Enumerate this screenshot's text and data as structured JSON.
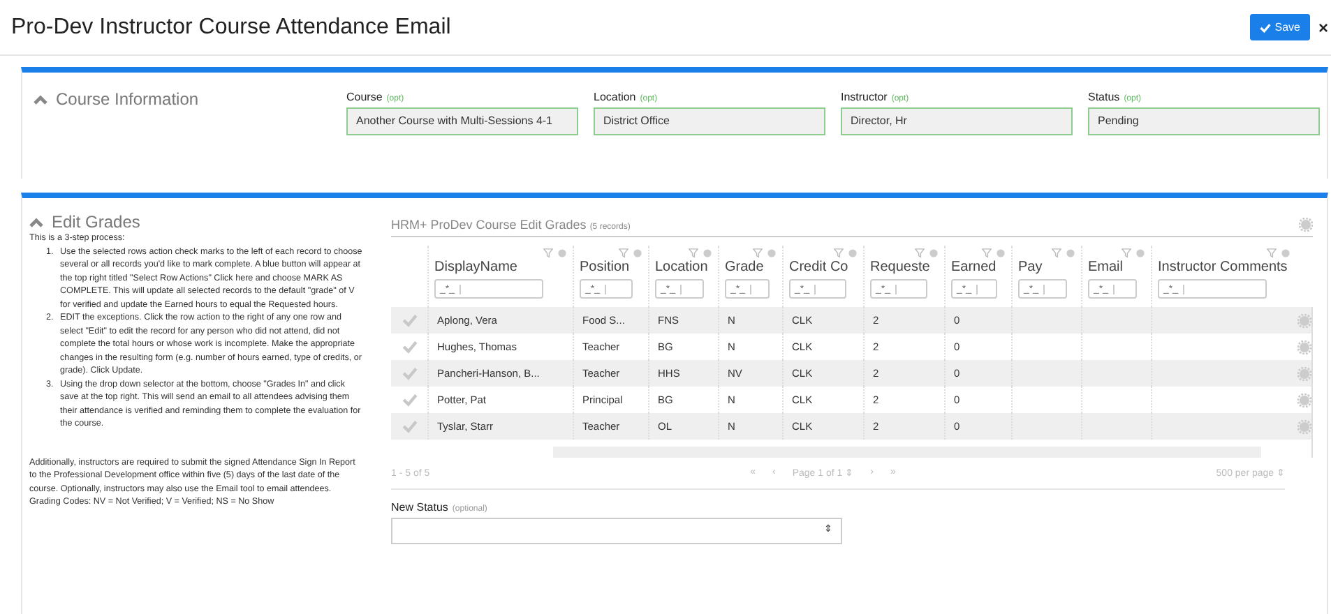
{
  "header": {
    "title": "Pro-Dev Instructor Course Attendance Email",
    "save_button": "Save",
    "close": "×"
  },
  "course_information": {
    "title": "Course Information",
    "fields": [
      {
        "label": "Course",
        "hint": "(opt)",
        "value": "Another Course with Multi-Sessions 4-1"
      },
      {
        "label": "Location",
        "hint": "(opt)",
        "value": "District Office"
      },
      {
        "label": "Instructor",
        "hint": "(opt)",
        "value": "Director, Hr"
      },
      {
        "label": "Status",
        "hint": "(opt)",
        "value": "Pending"
      }
    ]
  },
  "edit_grades": {
    "title": "Edit Grades",
    "intro": "This is a 3-step process:",
    "steps": [
      {
        "number": "1.",
        "text": "Use the selected rows action check marks to the left of each record to choose several or all records you'd like to mark complete. A blue button will appear at the top right titled \"Select Row Actions\" Click here and choose MARK AS COMPLETE. This will update all selected records to the default \"grade\" of V for verified and update the Earned hours to equal the Requested hours."
      },
      {
        "number": "2.",
        "text": "EDIT the exceptions. Click the row action to the right of any one row and select \"Edit\" to edit the record for any person who did not attend, did not complete the total hours or whose work is incomplete. Make the appropriate changes in the resulting form (e.g. number of hours earned, type of credits, or grade). Click Update."
      },
      {
        "number": "3.",
        "text": "Using the drop down selector at the bottom, choose \"Grades In\" and click save at the top right. This will send an email to all attendees advising them their attendance is verified and reminding them to complete the evaluation for the course."
      }
    ],
    "note": "Additionally, instructors are required to submit the signed Attendance Sign In Report to the Professional Development office within five (5) days of the last date of the course. Optionally, instructors may also use the Email tool to email attendees. Grading Codes: NV = Not Verified; V = Verified; NS = No Show"
  },
  "grid": {
    "title": "HRM+ ProDev Course Edit Grades",
    "count": "(5 records)",
    "filter_placeholder": "_*_",
    "columns": [
      "DisplayName",
      "Position",
      "Location",
      "Grade",
      "Credit Co",
      "Requeste",
      "Earned",
      "Pay",
      "Email",
      "Instructor Comments"
    ],
    "rows": [
      {
        "cells": [
          "Aplong, Vera",
          "Food S...",
          "FNS",
          "N",
          "CLK",
          "2",
          "0"
        ]
      },
      {
        "cells": [
          "Hughes, Thomas",
          "Teacher",
          "BG",
          "N",
          "CLK",
          "2",
          "0"
        ]
      },
      {
        "cells": [
          "Pancheri-Hanson, B...",
          "Teacher",
          "HHS",
          "NV",
          "CLK",
          "2",
          "0"
        ]
      },
      {
        "cells": [
          "Potter, Pat",
          "Principal",
          "BG",
          "N",
          "CLK",
          "2",
          "0"
        ]
      },
      {
        "cells": [
          "Tyslar, Starr",
          "Teacher",
          "OL",
          "N",
          "CLK",
          "2",
          "0"
        ]
      }
    ],
    "range": "1 - 5 of 5",
    "first": "«",
    "prev": "‹",
    "page": "Page 1 of 1 ⇕",
    "next": "›",
    "last": "»",
    "per_page": "500 per page ⇕"
  },
  "new_status": {
    "label": "New Status",
    "hint": "(optional)",
    "arrow": "⇕"
  }
}
